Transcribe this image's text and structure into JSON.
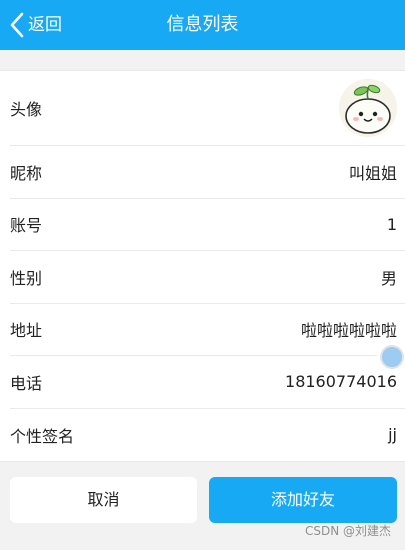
{
  "header": {
    "back_label": "返回",
    "title": "信息列表"
  },
  "profile": {
    "rows": [
      {
        "label": "头像",
        "value": ""
      },
      {
        "label": "昵称",
        "value": "叫姐姐"
      },
      {
        "label": "账号",
        "value": "1"
      },
      {
        "label": "性别",
        "value": "男"
      },
      {
        "label": "地址",
        "value": "啦啦啦啦啦啦"
      },
      {
        "label": "电话",
        "value": "18160774016"
      },
      {
        "label": "个性签名",
        "value": "jj"
      }
    ]
  },
  "actions": {
    "cancel_label": "取消",
    "add_friend_label": "添加好友"
  },
  "watermark": "CSDN @刘建杰",
  "colors": {
    "accent": "#18a9f5",
    "background": "#f2f2f2"
  }
}
